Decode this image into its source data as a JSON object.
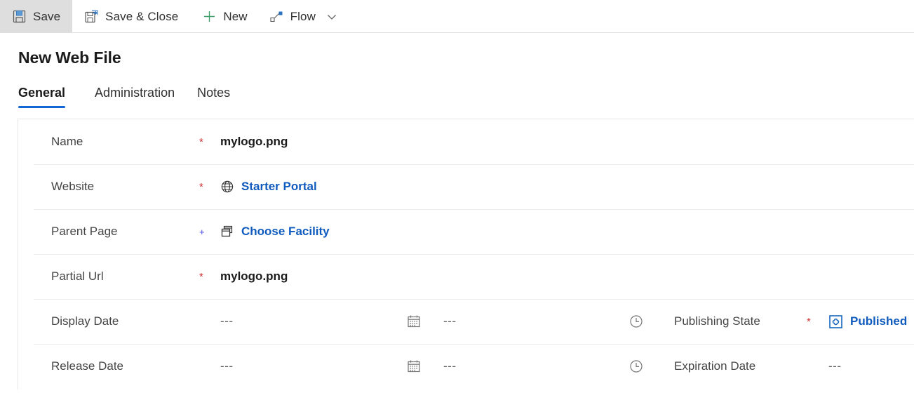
{
  "colors": {
    "accent": "#1267d4",
    "link": "#0f5bbd",
    "required": "#d13438",
    "recommended": "#4646e0",
    "new_plus": "#107c41",
    "toolbar_active_bg": "#dedede"
  },
  "commandbar": {
    "buttons": [
      {
        "id": "save",
        "label": "Save",
        "icon": "save-icon",
        "active": true
      },
      {
        "id": "save-close",
        "label": "Save & Close",
        "icon": "save-and-close-icon",
        "active": false
      },
      {
        "id": "new",
        "label": "New",
        "icon": "plus-icon",
        "active": false
      },
      {
        "id": "flow",
        "label": "Flow",
        "icon": "flow-icon",
        "active": false
      }
    ],
    "overflow_icon": "chevron-down-icon"
  },
  "page": {
    "title": "New Web File"
  },
  "tabs": [
    {
      "label": "General",
      "selected": true
    },
    {
      "label": "Administration",
      "selected": false
    },
    {
      "label": "Notes",
      "selected": false
    }
  ],
  "form": {
    "rows": [
      {
        "label": "Name",
        "marker": "*",
        "marker_kind": "required",
        "value": "mylogo.png",
        "value_kind": "text",
        "value_icon": null
      },
      {
        "label": "Website",
        "marker": "*",
        "marker_kind": "required",
        "value": "Starter Portal",
        "value_kind": "link",
        "value_icon": "globe-icon"
      },
      {
        "label": "Parent Page",
        "marker": "+",
        "marker_kind": "recommended",
        "value": "Choose Facility",
        "value_kind": "link",
        "value_icon": "pages-icon"
      },
      {
        "label": "Partial Url",
        "marker": "*",
        "marker_kind": "required",
        "value": "mylogo.png",
        "value_kind": "text",
        "value_icon": null
      }
    ],
    "date_rows": [
      {
        "label": "Display Date",
        "date_value": "---",
        "calendar_icon": "calendar-icon",
        "time_value": "---",
        "clock_icon": "clock-icon",
        "right_label": "Publishing State",
        "right_marker": "*",
        "right_value": "Published",
        "right_value_kind": "link",
        "right_value_icon": "publishing-state-icon"
      },
      {
        "label": "Release Date",
        "date_value": "---",
        "calendar_icon": "calendar-icon",
        "time_value": "---",
        "clock_icon": "clock-icon",
        "right_label": "Expiration Date",
        "right_marker": "",
        "right_value": "---",
        "right_value_kind": "empty",
        "right_value_icon": null
      }
    ]
  }
}
